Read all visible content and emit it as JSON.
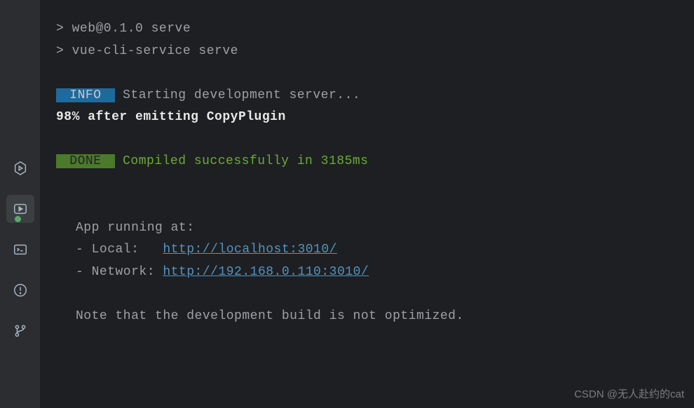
{
  "terminal": {
    "line1": "> web@0.1.0 serve",
    "line2": "> vue-cli-service serve",
    "info_badge": " INFO ",
    "info_text": " Starting development server...",
    "progress": "98% after emitting CopyPlugin",
    "done_badge": " DONE ",
    "done_text": " Compiled successfully in 3185ms",
    "app_running": "App running at:",
    "local_label": "- Local:   ",
    "local_url": "http://localhost:3010/",
    "network_label": "- Network: ",
    "network_url": "http://192.168.0.110:3010/",
    "note": "Note that the development build is not optimized."
  },
  "watermark": "CSDN @无人赴约的cat"
}
